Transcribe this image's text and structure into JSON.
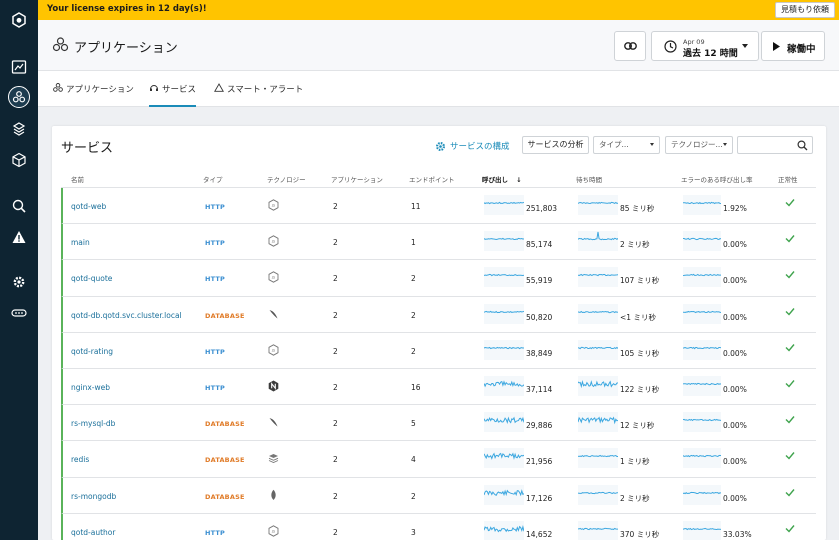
{
  "license_banner": {
    "text": "Your license expires in 12 day(s)!",
    "quote_button": "見積もり依頼"
  },
  "header": {
    "title": "アプリケーション",
    "time_range": {
      "date": "Apr 09",
      "label": "過去 12 時間"
    },
    "live_label": "稼働中"
  },
  "tabs": [
    {
      "label": "アプリケーション",
      "icon": "applications-icon"
    },
    {
      "label": "サービス",
      "icon": "services-icon"
    },
    {
      "label": "スマート・アラート",
      "icon": "alert-icon"
    }
  ],
  "services_card": {
    "title": "サービス",
    "config_link": "サービスの構成",
    "analyze_button": "サービスの分析",
    "type_filter": "タイプ...",
    "tech_filter": "テクノロジー...",
    "search_placeholder": ""
  },
  "table": {
    "columns": [
      "名前",
      "タイプ",
      "テクノロジー",
      "アプリケーション",
      "エンドポイント",
      "呼び出し",
      "待ち時間",
      "エラーのある呼び出し率",
      "正常性"
    ],
    "sort_indicator": "↓",
    "rows": [
      {
        "name": "qotd-web",
        "type": "HTTP",
        "tech": "http",
        "apps": "2",
        "endpoints": "11",
        "calls": "251,803",
        "latency": "85 ミリ秒",
        "error_rate": "1.92%",
        "health": "ok"
      },
      {
        "name": "main",
        "type": "HTTP",
        "tech": "http",
        "apps": "2",
        "endpoints": "1",
        "calls": "85,174",
        "latency": "2 ミリ秒",
        "error_rate": "0.00%",
        "health": "ok"
      },
      {
        "name": "qotd-quote",
        "type": "HTTP",
        "tech": "http",
        "apps": "2",
        "endpoints": "2",
        "calls": "55,919",
        "latency": "107 ミリ秒",
        "error_rate": "0.00%",
        "health": "ok"
      },
      {
        "name": "qotd-db.qotd.svc.cluster.local",
        "type": "DATABASE",
        "tech": "mysql",
        "apps": "2",
        "endpoints": "2",
        "calls": "50,820",
        "latency": "<1 ミリ秒",
        "error_rate": "0.00%",
        "health": "ok"
      },
      {
        "name": "qotd-rating",
        "type": "HTTP",
        "tech": "http",
        "apps": "2",
        "endpoints": "2",
        "calls": "38,849",
        "latency": "105 ミリ秒",
        "error_rate": "0.00%",
        "health": "ok"
      },
      {
        "name": "nginx-web",
        "type": "HTTP",
        "tech": "nginx",
        "apps": "2",
        "endpoints": "16",
        "calls": "37,114",
        "latency": "122 ミリ秒",
        "error_rate": "0.00%",
        "health": "ok"
      },
      {
        "name": "rs-mysql-db",
        "type": "DATABASE",
        "tech": "mysql",
        "apps": "2",
        "endpoints": "5",
        "calls": "29,886",
        "latency": "12 ミリ秒",
        "error_rate": "0.00%",
        "health": "ok"
      },
      {
        "name": "redis",
        "type": "DATABASE",
        "tech": "redis",
        "apps": "2",
        "endpoints": "4",
        "calls": "21,956",
        "latency": "1 ミリ秒",
        "error_rate": "0.00%",
        "health": "ok"
      },
      {
        "name": "rs-mongodb",
        "type": "DATABASE",
        "tech": "mongodb",
        "apps": "2",
        "endpoints": "2",
        "calls": "17,126",
        "latency": "2 ミリ秒",
        "error_rate": "0.00%",
        "health": "ok"
      },
      {
        "name": "qotd-author",
        "type": "HTTP",
        "tech": "http",
        "apps": "2",
        "endpoints": "3",
        "calls": "14,652",
        "latency": "370 ミリ秒",
        "error_rate": "33.03%",
        "health": "ok"
      }
    ]
  },
  "colors": {
    "nav_bg": "#0e2432",
    "banner": "#ffc400",
    "accent": "#1a8bb8",
    "healthy": "#3fa34d",
    "http": "#3b8fd1",
    "database": "#e07b28",
    "spark": "#3ba7e0"
  },
  "nav_icons": [
    "instana-logo-icon",
    "dashboard-icon",
    "applications-icon",
    "platforms-icon",
    "infrastructure-icon",
    "analytics-icon",
    "events-icon",
    "settings-icon",
    "more-icon"
  ]
}
